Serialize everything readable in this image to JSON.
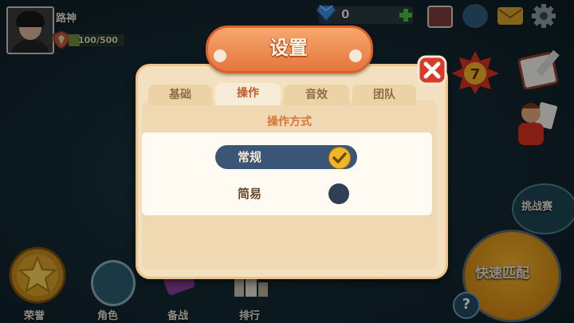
{
  "player": {
    "name": "路神",
    "exp_text": "100/500",
    "exp_progress": 0.2
  },
  "topbar": {
    "gems": "0"
  },
  "right": {
    "challenge_label": "挑战赛",
    "quick_match_label": "快速匹配",
    "help_label": "?",
    "event_number": "7"
  },
  "bottom_nav": [
    {
      "label": "荣誉",
      "icon": "honor-star-icon"
    },
    {
      "label": "角色",
      "icon": "character-icon"
    },
    {
      "label": "备战",
      "icon": "battle-prep-icon"
    },
    {
      "label": "排行",
      "icon": "ranking-icon"
    }
  ],
  "dialog": {
    "title": "设置",
    "tabs": [
      "基础",
      "操作",
      "音效",
      "团队"
    ],
    "active_tab": "操作",
    "section_title": "操作方式",
    "options": [
      {
        "label": "常规",
        "selected": true
      },
      {
        "label": "简易",
        "selected": false
      }
    ]
  },
  "colors": {
    "accent_orange": "#e4763c",
    "selected_option": "#3a5576",
    "check_yellow": "#f0b626"
  }
}
